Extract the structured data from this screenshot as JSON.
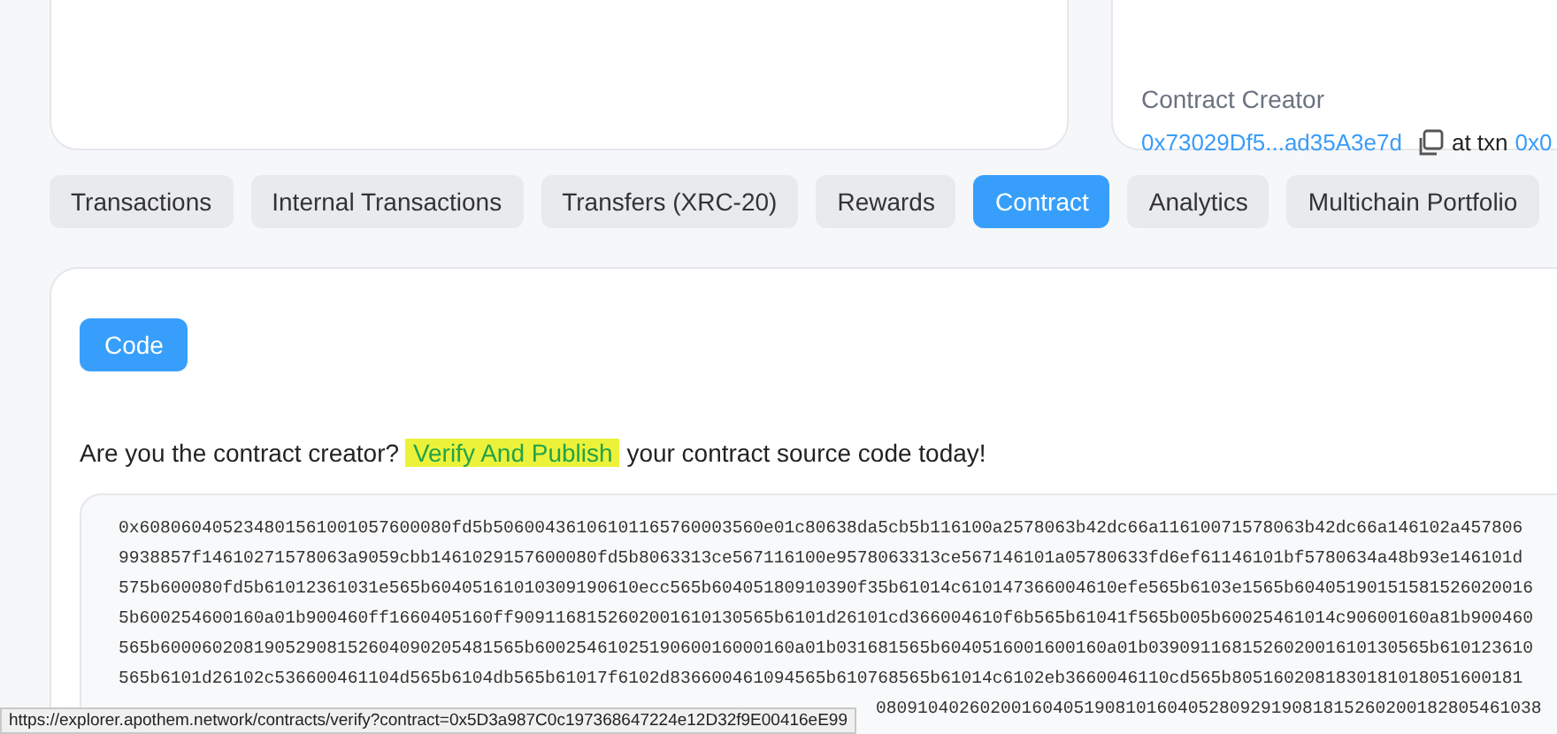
{
  "contract_creator": {
    "label": "Contract Creator",
    "address": "0x73029Df5...ad35A3e7d",
    "at_txn": "at txn",
    "txn": "0x0"
  },
  "tabs": [
    {
      "label": "Transactions",
      "selected": false
    },
    {
      "label": "Internal Transactions",
      "selected": false
    },
    {
      "label": "Transfers (XRC-20)",
      "selected": false
    },
    {
      "label": "Rewards",
      "selected": false
    },
    {
      "label": "Contract",
      "selected": true
    },
    {
      "label": "Analytics",
      "selected": false
    },
    {
      "label": "Multichain Portfolio",
      "selected": false
    }
  ],
  "code_button": "Code",
  "verify": {
    "before": "Are you the contract creator?",
    "link": "Verify And Publish",
    "after": "your contract source code today!"
  },
  "bytecode_lines": [
    "0x608060405234801561001057600080fd5b50600436106101165760003560e01c80638da5cb5b116100a2578063b42dc66a11610071578063b42dc66a146102a457806",
    "9938857f14610271578063a9059cbb1461029157600080fd5b8063313ce567116100e9578063313ce567146101a05780633fd6ef61146101bf5780634a48b93e146101d",
    "575b600080fd5b61012361031e565b60405161010309190610ecc565b60405180910390f35b61014c610147366004610efe565b6103e1565b60405190151581526020016",
    "5b600254600160a01b900460ff1660405160ff9091168152602001610130565b6101d26101cd366004610f6b565b61041f565b005b60025461014c90600160a81b900460",
    "565b60006020819052908152604090205481565b6002546102519060016000160a01b031681565b6040516001600160a01b039091168152602001610130565b610123610",
    "565b6101d26102c536600461104d565b6104db565b61017f6102d836600461094565b610768565b61014c6102eb3660046110cd565b8051602081830181018051600181"
  ],
  "bytecode_tail": "0809104026020016040519081016040528092919081815260200182805461038",
  "status_url": "https://explorer.apothem.network/contracts/verify?contract=0x5D3a987C0c197368647224e12D32f9E00416eE99"
}
